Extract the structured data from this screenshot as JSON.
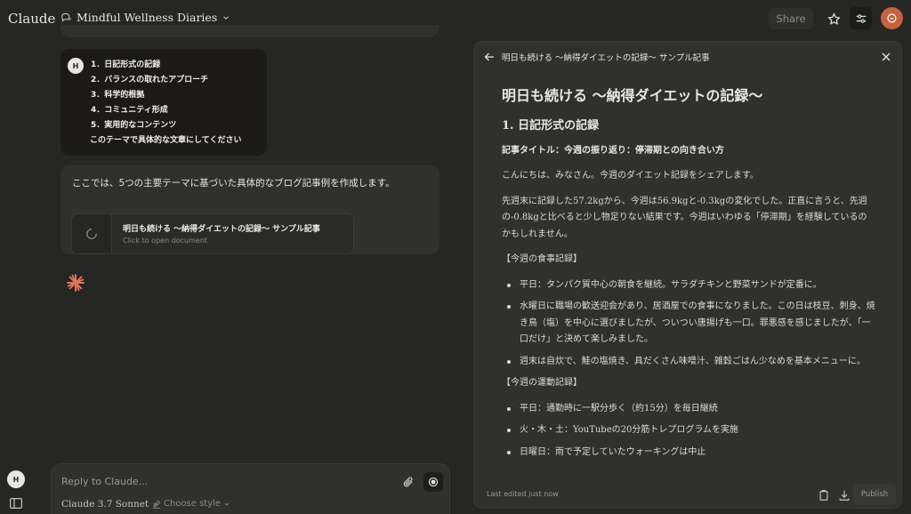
{
  "app": {
    "logo": "Claude"
  },
  "header": {
    "conversation_title": "Mindful Wellness Diaries",
    "share_label": "Share",
    "user_initial": "H"
  },
  "chat": {
    "user_message": {
      "avatar": "H",
      "lines": [
        "1．日記形式の記録",
        "2．バランスの取れたアプローチ",
        "3．科学的根拠",
        "4．コミュニティ形成",
        "5．実用的なコンテンツ",
        "このテーマで具体的な文章にしてください"
      ]
    },
    "assistant_message": {
      "text": "ここでは、5つの主要テーマに基づいた具体的なブログ記事例を作成します。",
      "document_card": {
        "title": "明日も続ける ～納得ダイエットの記録～ サンプル記事",
        "subtitle": "Click to open document"
      }
    }
  },
  "composer": {
    "placeholder": "Reply to Claude...",
    "model": "Claude 3.7 Sonnet",
    "style": "Choose style"
  },
  "sidebar": {
    "user_initial": "H"
  },
  "artifact": {
    "header_title": "明日も続ける ～納得ダイエットの記録～ サンプル記事",
    "h1": "明日も続ける ～納得ダイエットの記録～",
    "h2": "1. 日記形式の記録",
    "h3": "記事タイトル：今週の振り返り：停滞期との向き合い方",
    "p1": "こんにちは、みなさん。今週のダイエット記録をシェアします。",
    "p2": "先週末に記録した57.2kgから、今週は56.9kgと-0.3kgの変化でした。正直に言うと、先週の-0.8kgと比べると少し物足りない結果です。今週はいわゆる「停滞期」を経験しているのかもしれません。",
    "meal_heading": "【今週の食事記録】",
    "meal_items": [
      "平日：タンパク質中心の朝食を継続。サラダチキンと野菜サンドが定番に。",
      "水曜日に職場の歓送迎会があり、居酒屋での食事になりました。この日は枝豆、刺身、焼き鳥（塩）を中心に選びましたが、ついつい唐揚げも一口。罪悪感を感じましたが、「一口だけ」と決めて楽しみました。",
      "週末は自炊で、鮭の塩焼き、具だくさん味噌汁、雑穀ごはん少なめを基本メニューに。"
    ],
    "exercise_heading": "【今週の運動記録】",
    "exercise_items": [
      "平日：通勤時に一駅分歩く（約15分）を毎日継続",
      "火・木・土：YouTubeの20分筋トレプログラムを実施",
      "日曜日：雨で予定していたウォーキングは中止"
    ],
    "last_edited": "Last edited just now",
    "publish_label": "Publish"
  },
  "colors": {
    "accent": "#c4643f",
    "background": "#262624",
    "panel": "#30302e"
  }
}
